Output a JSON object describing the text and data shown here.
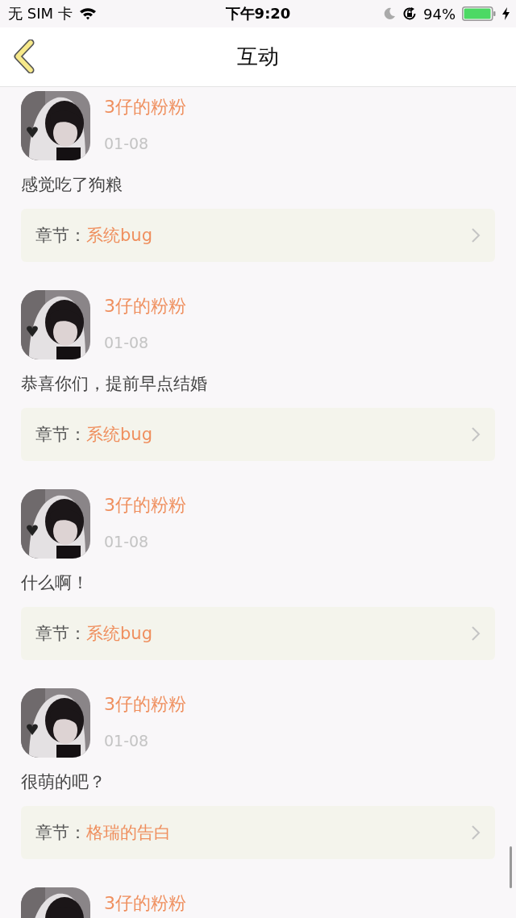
{
  "status_bar": {
    "carrier": "无 SIM 卡",
    "time": "下午9:20",
    "battery": "94%"
  },
  "nav": {
    "title": "互动"
  },
  "comments": [
    {
      "name": "3仔的粉粉",
      "date": "01-08",
      "text": "感觉吃了狗粮",
      "chapter_label": "章节：",
      "chapter": "系统bug"
    },
    {
      "name": "3仔的粉粉",
      "date": "01-08",
      "text": "恭喜你们，提前早点结婚",
      "chapter_label": "章节：",
      "chapter": "系统bug"
    },
    {
      "name": "3仔的粉粉",
      "date": "01-08",
      "text": "什么啊！",
      "chapter_label": "章节：",
      "chapter": "系统bug"
    },
    {
      "name": "3仔的粉粉",
      "date": "01-08",
      "text": "很萌的吧？",
      "chapter_label": "章节：",
      "chapter": "格瑞的告白"
    },
    {
      "name": "3仔的粉粉"
    }
  ]
}
